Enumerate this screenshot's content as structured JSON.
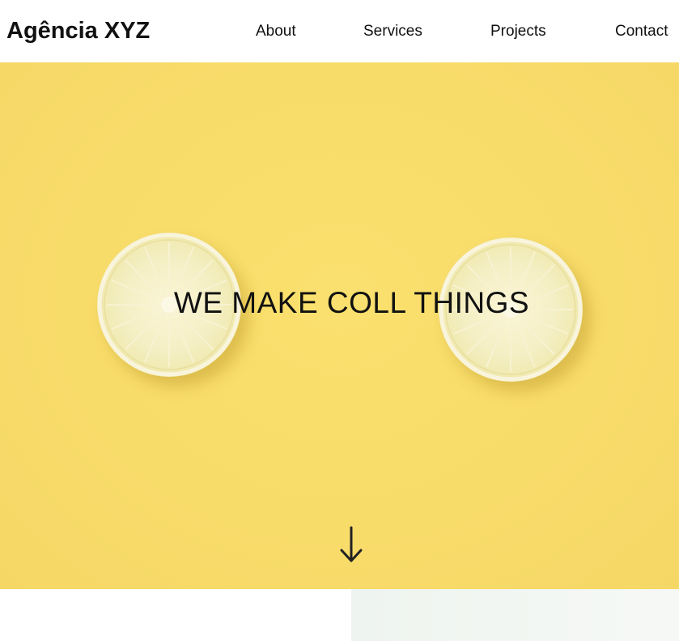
{
  "header": {
    "brand": "Agência XYZ",
    "nav": [
      {
        "label": "About"
      },
      {
        "label": "Services"
      },
      {
        "label": "Projects"
      },
      {
        "label": "Contact"
      }
    ]
  },
  "hero": {
    "headline": "WE MAKE COLL THINGS",
    "background_color": "#f8dc6a",
    "scroll_icon": "arrow-down-icon"
  },
  "colors": {
    "text": "#111111",
    "lemon": "#f4efc4",
    "below_right": "#eef4ef"
  }
}
